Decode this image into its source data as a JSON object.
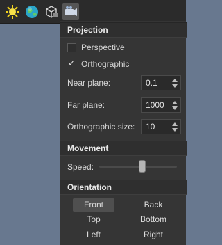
{
  "toolbar": {
    "icons": [
      "sun-icon",
      "globe-icon",
      "cube-icon",
      "camera-settings-icon"
    ]
  },
  "projection": {
    "header": "Projection",
    "perspective_label": "Perspective",
    "perspective_checked": false,
    "orthographic_label": "Orthographic",
    "orthographic_checked": true,
    "near_plane_label": "Near plane:",
    "near_plane_value": "0.1",
    "far_plane_label": "Far plane:",
    "far_plane_value": "1000",
    "ortho_size_label": "Orthographic size:",
    "ortho_size_value": "10"
  },
  "movement": {
    "header": "Movement",
    "speed_label": "Speed:",
    "speed_level": 0.55
  },
  "orientation": {
    "header": "Orientation",
    "front": "Front",
    "back": "Back",
    "top": "Top",
    "bottom": "Bottom",
    "left": "Left",
    "right": "Right",
    "selected": "Front"
  },
  "colors": {
    "panel_bg": "#353535",
    "header_bg": "#2f2f2f",
    "viewport_bg": "#68788f",
    "sun": "#f2d21a",
    "globe": "#2aa5c8"
  }
}
